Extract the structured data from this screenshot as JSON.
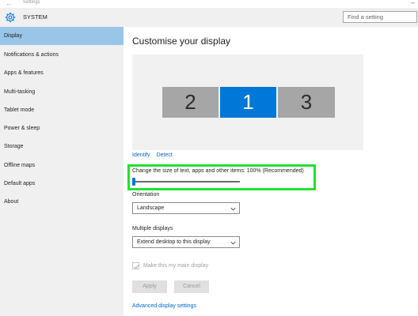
{
  "window": {
    "title": "Settings"
  },
  "header": {
    "section": "SYSTEM",
    "search_placeholder": "Find a setting"
  },
  "sidebar": {
    "items": [
      {
        "label": "Display",
        "active": true
      },
      {
        "label": "Notifications & actions"
      },
      {
        "label": "Apps & features"
      },
      {
        "label": "Multi-tasking"
      },
      {
        "label": "Tablet mode"
      },
      {
        "label": "Power & sleep"
      },
      {
        "label": "Storage"
      },
      {
        "label": "Offline maps"
      },
      {
        "label": "Default apps"
      },
      {
        "label": "About"
      }
    ]
  },
  "main": {
    "title": "Customise your display",
    "monitors": [
      {
        "label": "2",
        "selected": false
      },
      {
        "label": "1",
        "selected": true
      },
      {
        "label": "3",
        "selected": false
      }
    ],
    "identify_label": "Identify",
    "detect_label": "Detect",
    "scale_label": "Change the size of text, apps and other items: 100% (Recommended)",
    "scale_slider_fraction": 0,
    "orientation_label": "Orientation",
    "orientation_value": "Landscape",
    "multiple_displays_label": "Multiple displays",
    "multiple_displays_value": "Extend desktop to this display",
    "main_display_label": "Make this my main display",
    "main_display_checked": true,
    "apply_label": "Apply",
    "cancel_label": "Cancel",
    "advanced_label": "Advanced display settings"
  },
  "colors": {
    "accent": "#0078d7",
    "sidebar_active": "#99c5e9",
    "highlight_box": "#22e032",
    "monitor_inactive": "#a6a6a6"
  }
}
